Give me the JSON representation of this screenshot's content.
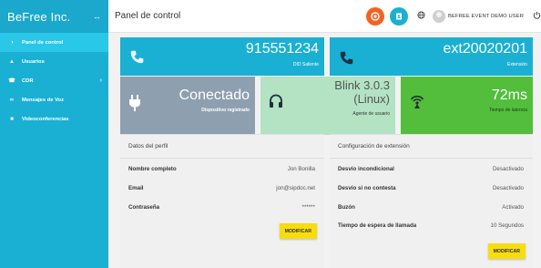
{
  "app": {
    "brand": "BeFree Inc.",
    "brand_toggle_icon": "collapse-arrows-icon"
  },
  "sidebar": {
    "items": [
      {
        "label": "Panel de control",
        "icon": "dashboard-icon",
        "active": true
      },
      {
        "label": "Usuarios",
        "icon": "user-icon",
        "active": false
      },
      {
        "label": "CDR",
        "icon": "phone-icon",
        "active": false,
        "has_chevron": true
      },
      {
        "label": "Mensajes de Voz",
        "icon": "voicemail-icon",
        "active": false
      },
      {
        "label": "Videoconferencias",
        "icon": "video-icon",
        "active": false
      }
    ]
  },
  "topbar": {
    "title": "Panel de control",
    "user_name": "BEFREE EVENT DEMO USER",
    "colors": {
      "orange": "#f26322",
      "blue": "#1ab0d3"
    }
  },
  "cards": {
    "did": {
      "value": "915551234",
      "label": "DID Saliente",
      "icon": "phone-icon",
      "color": "#1ab0d3"
    },
    "extension": {
      "value": "ext20020201",
      "label": "Extensión",
      "icon": "phone-icon",
      "color": "#1ab0d3"
    },
    "connection": {
      "value": "Conectado",
      "label": "Dispositivo registrado",
      "icon": "plug-icon",
      "color": "#8ea0b0"
    },
    "agent": {
      "value_line1": "Blink 3.0.3",
      "value_line2": "(Linux)",
      "label": "Agente de usuario",
      "icon": "headset-icon",
      "color": "#b3e3c3"
    },
    "latency": {
      "value": "72ms",
      "label": "Tiempo de latencia",
      "icon": "wifi-icon",
      "color": "#52be3c"
    }
  },
  "profile": {
    "title": "Datos del perfil",
    "rows": [
      {
        "label": "Nombre completo",
        "value": "Jon Bonilla"
      },
      {
        "label": "Email",
        "value": "jon@sipdoc.net"
      },
      {
        "label": "Contraseña",
        "value": "******"
      }
    ],
    "button": "MODIFICAR"
  },
  "extension_config": {
    "title": "Configuración de extensión",
    "rows": [
      {
        "label": "Desvío incondicional",
        "value": "Desactivado"
      },
      {
        "label": "Desvío si no contesta",
        "value": "Desactivado"
      },
      {
        "label": "Buzón",
        "value": "Activado"
      },
      {
        "label": "Tiempo de espera de llamada",
        "value": "10 Segundos"
      }
    ],
    "button": "MODIFICAR"
  }
}
